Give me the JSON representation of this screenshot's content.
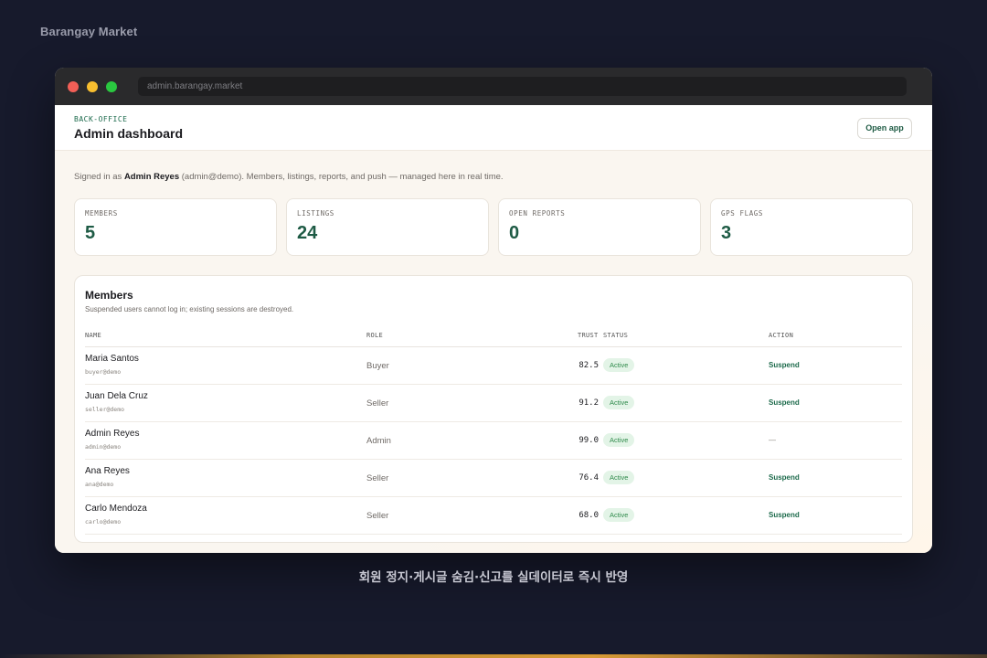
{
  "brand": "Barangay Market",
  "browser": {
    "url": "admin.barangay.market"
  },
  "header": {
    "eyebrow": "BACK-OFFICE",
    "title": "Admin dashboard",
    "open_app_label": "Open app"
  },
  "signed_in": {
    "prefix": "Signed in as ",
    "user": "Admin Reyes",
    "suffix": " (admin@demo). Members, listings, reports, and push — managed here in real time."
  },
  "stats": [
    {
      "label": "MEMBERS",
      "value": "5"
    },
    {
      "label": "LISTINGS",
      "value": "24"
    },
    {
      "label": "OPEN REPORTS",
      "value": "0"
    },
    {
      "label": "GPS FLAGS",
      "value": "3"
    }
  ],
  "members": {
    "title": "Members",
    "subtitle": "Suspended users cannot log in; existing sessions are destroyed.",
    "columns": {
      "name": "NAME",
      "role": "ROLE",
      "trust": "TRUST",
      "status": "STATUS",
      "action": "ACTION"
    },
    "rows": [
      {
        "name": "Maria Santos",
        "email": "buyer@demo",
        "role": "Buyer",
        "trust": "82.5",
        "status": "Active",
        "action": "Suspend"
      },
      {
        "name": "Juan Dela Cruz",
        "email": "seller@demo",
        "role": "Seller",
        "trust": "91.2",
        "status": "Active",
        "action": "Suspend"
      },
      {
        "name": "Admin Reyes",
        "email": "admin@demo",
        "role": "Admin",
        "trust": "99.0",
        "status": "Active",
        "action": "—"
      },
      {
        "name": "Ana Reyes",
        "email": "ana@demo",
        "role": "Seller",
        "trust": "76.4",
        "status": "Active",
        "action": "Suspend"
      },
      {
        "name": "Carlo Mendoza",
        "email": "carlo@demo",
        "role": "Seller",
        "trust": "68.0",
        "status": "Active",
        "action": "Suspend"
      }
    ]
  },
  "caption": "회원 정지·게시글 숨김·신고를 실데이터로 즉시 반영",
  "colors": {
    "accent": "#1e5b45",
    "status_bg": "#e3f4e7",
    "status_text": "#2f8a4b",
    "page_bg": "#171a2c"
  }
}
